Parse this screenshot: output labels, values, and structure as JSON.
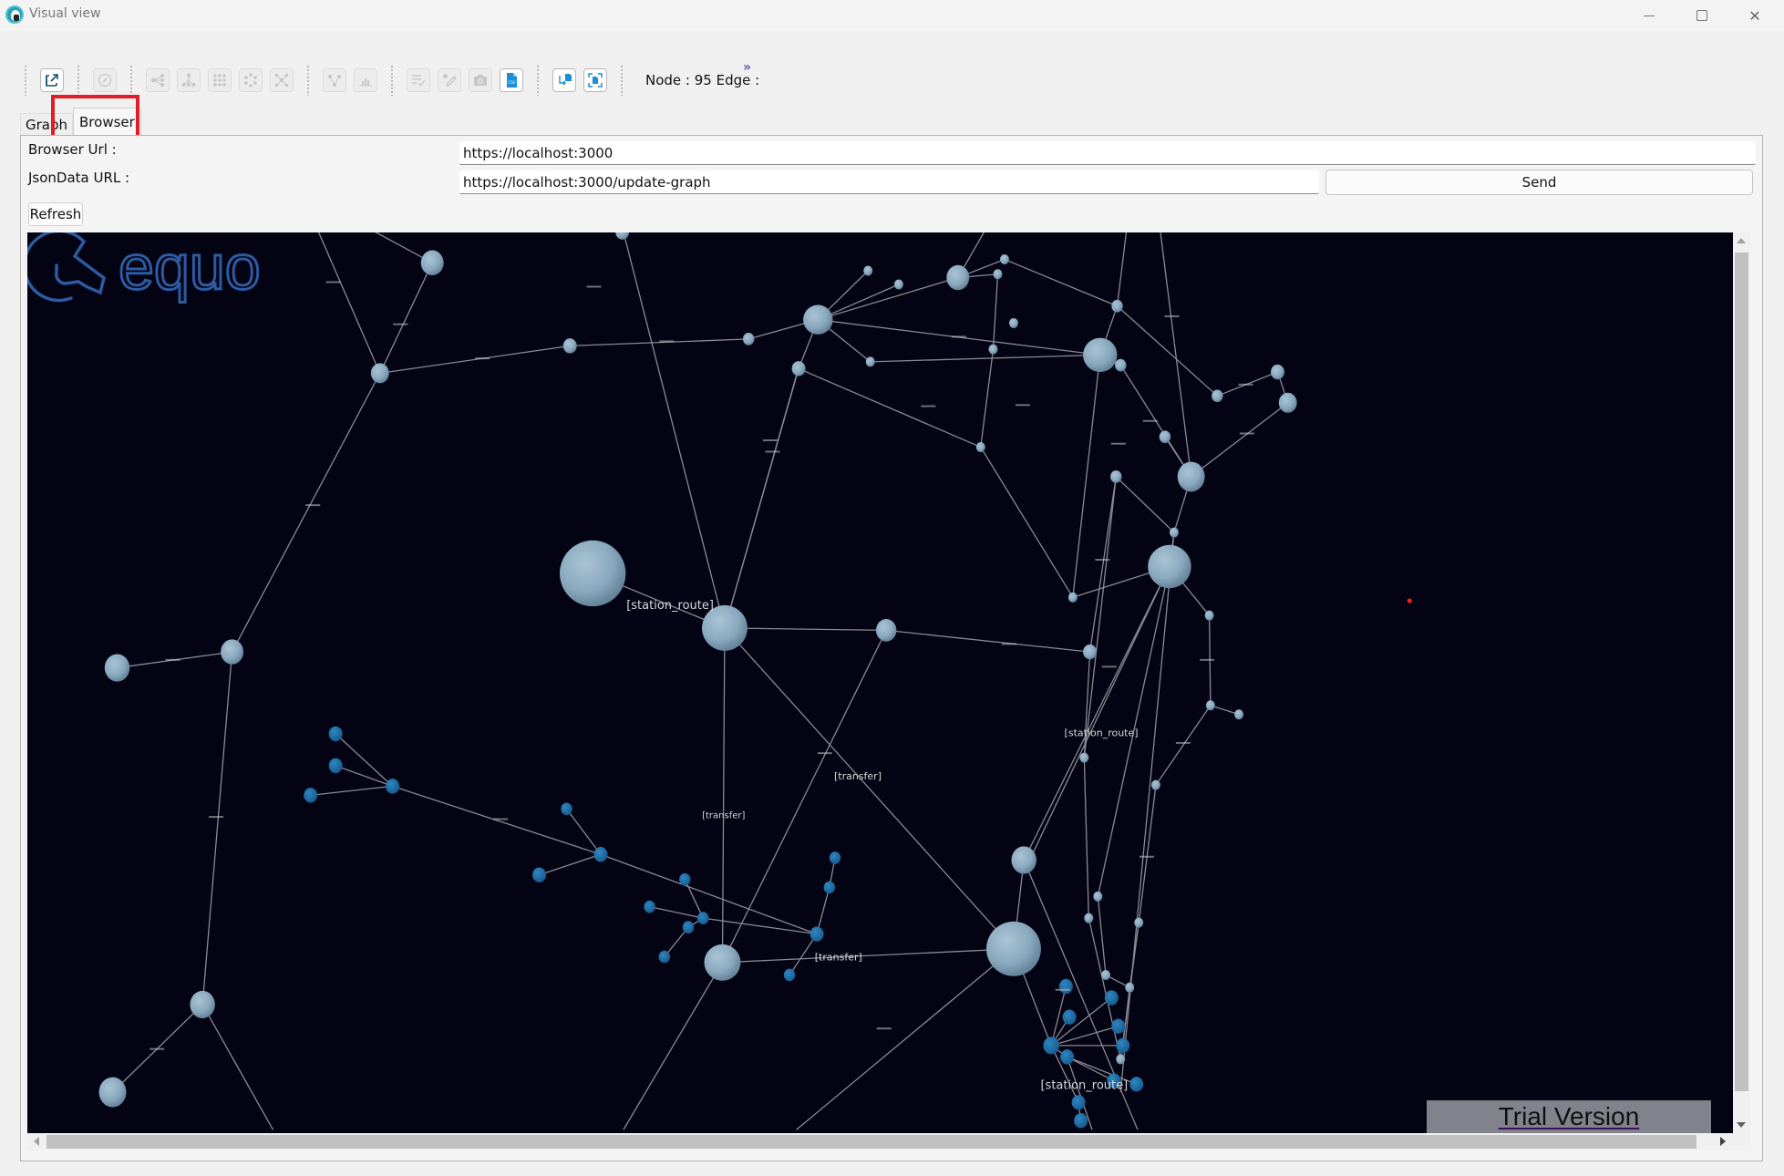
{
  "window": {
    "title": "Visual view",
    "controls": {
      "minimize": "minimize",
      "maximize": "maximize",
      "close": "close"
    }
  },
  "toolbar": {
    "groups": [
      [
        {
          "icon": "export-icon",
          "enabled": true
        }
      ],
      [
        {
          "icon": "compass-icon",
          "enabled": false
        }
      ],
      [
        {
          "icon": "tree-layout-icon",
          "enabled": false
        },
        {
          "icon": "hierarchy-layout-icon",
          "enabled": false
        },
        {
          "icon": "grid-layout-icon",
          "enabled": false
        },
        {
          "icon": "circle-layout-icon",
          "enabled": false
        },
        {
          "icon": "star-layout-icon",
          "enabled": false
        }
      ],
      [
        {
          "icon": "node-link-icon",
          "enabled": false
        },
        {
          "icon": "bar-chart-icon",
          "enabled": false
        }
      ],
      [
        {
          "icon": "checklist-icon",
          "enabled": false
        },
        {
          "icon": "edit-icon",
          "enabled": false
        },
        {
          "icon": "camera-icon",
          "enabled": false
        },
        {
          "icon": "csv-file-icon",
          "enabled": true
        }
      ],
      [
        {
          "icon": "import-file-icon",
          "enabled": true
        },
        {
          "icon": "fit-view-icon",
          "enabled": true
        }
      ]
    ],
    "status_text": "Node : 95 Edge :",
    "overflow": "»"
  },
  "tabs": [
    {
      "label": "Graph",
      "active": false
    },
    {
      "label": "Browser",
      "active": true
    }
  ],
  "browser_panel": {
    "browser_url_label": "Browser Url :",
    "browser_url_value": "https://localhost:3000",
    "json_url_label": "JsonData URL :",
    "json_url_value": "https://localhost:3000/update-graph",
    "send_label": "Send",
    "refresh_label": "Refresh"
  },
  "graph": {
    "node_count": 95,
    "colors": {
      "background": "#030313",
      "station_node": "#8fafc4",
      "stop_node": "#1f6fa8",
      "edge": "#8a8a94",
      "label": "#d8d8d8",
      "cursor_marker": "#ff1a1a"
    },
    "edge_labels": [
      "[station_route]",
      "[station_route]",
      "[station_route]",
      "[transfer]",
      "[transfer]",
      "[transfer]"
    ]
  },
  "watermark": {
    "brand": "equo",
    "notice": "Trial Version",
    "brand_color": "#2d5aa0"
  }
}
